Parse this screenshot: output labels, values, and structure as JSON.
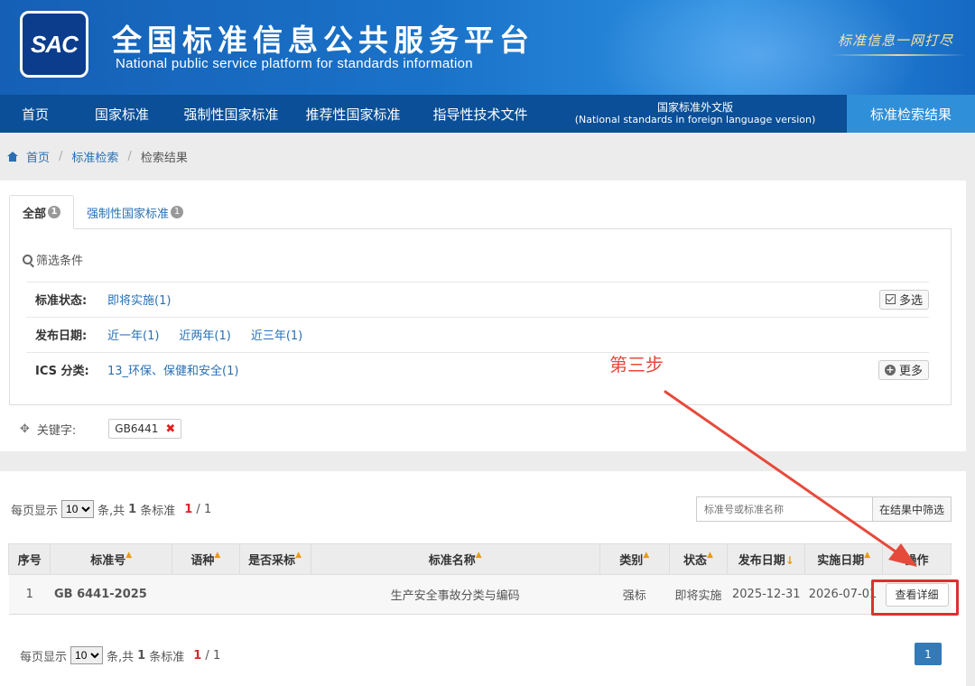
{
  "header": {
    "logo_text": "SAC",
    "title": "全国标准信息公共服务平台",
    "subtitle": "National public service platform  for standards information",
    "slogan": "标准信息一网打尽"
  },
  "nav": {
    "items": [
      {
        "label": "首页"
      },
      {
        "label": "国家标准"
      },
      {
        "label": "强制性国家标准"
      },
      {
        "label": "推荐性国家标准"
      },
      {
        "label": "指导性技术文件"
      },
      {
        "label": "国家标准外文版",
        "sub": "(National standards in foreign language version)"
      },
      {
        "label": "标准检索结果"
      }
    ]
  },
  "breadcrumb": {
    "home": "首页",
    "search": "标准检索",
    "current": "检索结果"
  },
  "tabs": [
    {
      "label": "全部",
      "count": "1"
    },
    {
      "label": "强制性国家标准",
      "count": "1"
    }
  ],
  "filters": {
    "heading": "筛选条件",
    "rows": [
      {
        "label": "标准状态:",
        "options": [
          "即将实施(1)"
        ],
        "button": "多选"
      },
      {
        "label": "发布日期:",
        "options": [
          "近一年(1)",
          "近两年(1)",
          "近三年(1)"
        ]
      },
      {
        "label": "ICS 分类:",
        "options": [
          "13_环保、保健和安全(1)"
        ],
        "button": "更多"
      }
    ],
    "keyword_label": "关键字:",
    "keyword_value": "GB6441"
  },
  "annotation": {
    "step_text": "第三步",
    "color": "#e64a3b"
  },
  "results": {
    "per_page_label": "每页显示",
    "per_page_value": "10",
    "summary_prefix": "条,共",
    "total": "1",
    "summary_suffix": "条标准",
    "page_current": "1",
    "page_sep": "/",
    "page_total": "1",
    "search_placeholder": "标准号或标准名称",
    "search_button": "在结果中筛选",
    "columns": [
      "序号",
      "标准号",
      "语种",
      "是否采标",
      "标准名称",
      "类别",
      "状态",
      "发布日期",
      "实施日期",
      "操作"
    ],
    "rows": [
      {
        "index": "1",
        "std_no": "GB 6441-2025",
        "lang": "",
        "adopted": "",
        "name": "生产安全事故分类与编码",
        "category": "强标",
        "status": "即将实施",
        "publish_date": "2025-12-31",
        "impl_date": "2026-07-01",
        "action": "查看详细"
      }
    ],
    "pager_button": "1"
  },
  "colors": {
    "nav_bg": "#0a4f97",
    "nav_active": "#2f8fd8",
    "link": "#2a6fb3",
    "accent_red": "#e02f2f",
    "page_btn": "#337ab7"
  }
}
